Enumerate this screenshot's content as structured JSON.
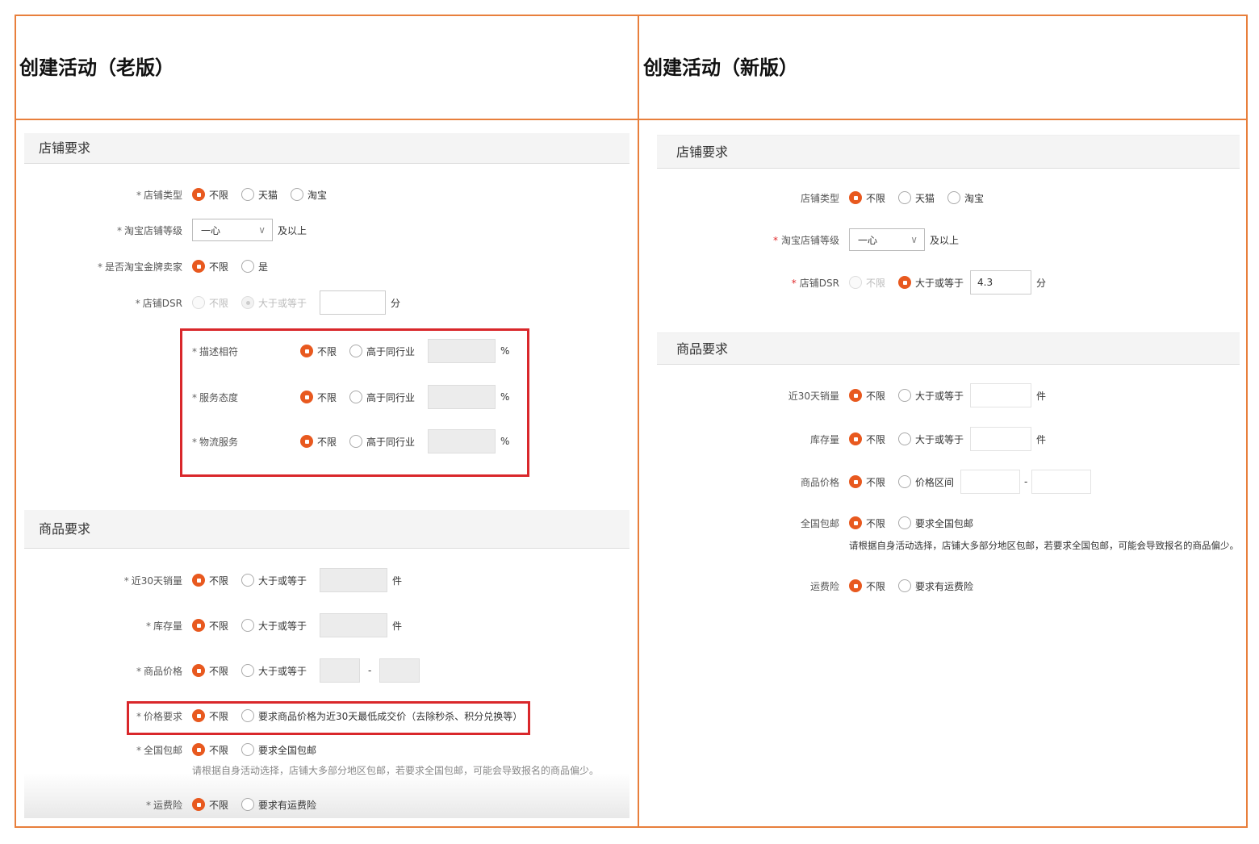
{
  "old": {
    "title": "创建活动（老版）",
    "shop_section": "店铺要求",
    "shop_type": {
      "label": "店铺类型",
      "options": [
        "不限",
        "天猫",
        "淘宝"
      ]
    },
    "tb_level": {
      "label": "淘宝店铺等级",
      "value": "一心",
      "suffix": "及以上"
    },
    "gold_seller": {
      "label": "是否淘宝金牌卖家",
      "options": [
        "不限",
        "是"
      ]
    },
    "dsr": {
      "label": "店铺DSR",
      "options": [
        "不限",
        "大于或等于"
      ],
      "unit": "分"
    },
    "desc_match": {
      "label": "描述相符",
      "options": [
        "不限",
        "高于同行业"
      ],
      "unit": "%"
    },
    "service": {
      "label": "服务态度",
      "options": [
        "不限",
        "高于同行业"
      ],
      "unit": "%"
    },
    "logistics": {
      "label": "物流服务",
      "options": [
        "不限",
        "高于同行业"
      ],
      "unit": "%"
    },
    "goods_section": "商品要求",
    "sales30": {
      "label": "近30天销量",
      "options": [
        "不限",
        "大于或等于"
      ],
      "unit": "件"
    },
    "stock": {
      "label": "库存量",
      "options": [
        "不限",
        "大于或等于"
      ],
      "unit": "件"
    },
    "price": {
      "label": "商品价格",
      "options": [
        "不限",
        "大于或等于"
      ],
      "dash": "-"
    },
    "price_req": {
      "label": "价格要求",
      "options": [
        "不限",
        "要求商品价格为近30天最低成交价（去除秒杀、积分兑换等）"
      ]
    },
    "free_ship": {
      "label": "全国包邮",
      "options": [
        "不限",
        "要求全国包邮"
      ],
      "hint": "请根据自身活动选择，店铺大多部分地区包邮，若要求全国包邮，可能会导致报名的商品偏少。"
    },
    "insurance": {
      "label": "运费险",
      "options": [
        "不限",
        "要求有运费险"
      ]
    }
  },
  "new": {
    "title": "创建活动（新版）",
    "shop_section": "店铺要求",
    "shop_type": {
      "label": "店铺类型",
      "options": [
        "不限",
        "天猫",
        "淘宝"
      ]
    },
    "tb_level": {
      "label": "淘宝店铺等级",
      "value": "一心",
      "suffix": "及以上"
    },
    "dsr": {
      "label": "店铺DSR",
      "options": [
        "不限",
        "大于或等于"
      ],
      "value": "4.3",
      "unit": "分"
    },
    "goods_section": "商品要求",
    "sales30": {
      "label": "近30天销量",
      "options": [
        "不限",
        "大于或等于"
      ],
      "unit": "件"
    },
    "stock": {
      "label": "库存量",
      "options": [
        "不限",
        "大于或等于"
      ],
      "unit": "件"
    },
    "price": {
      "label": "商品价格",
      "options": [
        "不限",
        "价格区间"
      ],
      "dash": "-"
    },
    "free_ship": {
      "label": "全国包邮",
      "options": [
        "不限",
        "要求全国包邮"
      ],
      "hint": "请根据自身活动选择，店铺大多部分地区包邮，若要求全国包邮，可能会导致报名的商品偏少。"
    },
    "insurance": {
      "label": "运费险",
      "options": [
        "不限",
        "要求有运费险"
      ]
    }
  },
  "required_mark": "*",
  "colors": {
    "accent": "#e8591f",
    "frame": "#e87f3c",
    "highlight": "#d9272b"
  }
}
